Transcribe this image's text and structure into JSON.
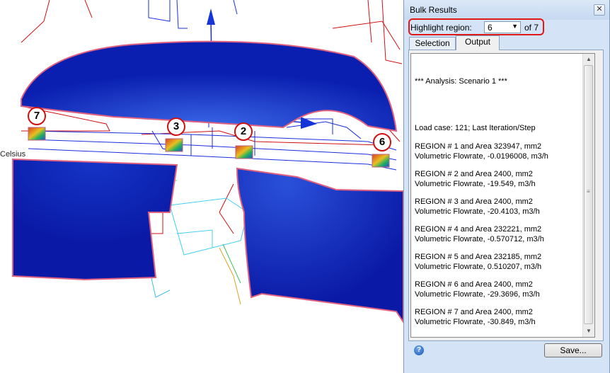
{
  "viewport": {
    "partial_label": "Celsius",
    "markers": [
      "7",
      "3",
      "2",
      "6"
    ]
  },
  "dialog": {
    "title": "Bulk Results",
    "close_glyph": "✕",
    "highlight_label": "Highlight region:",
    "highlight_value": "6",
    "highlight_of": "of 7",
    "tabs": [
      "Selection",
      "Output"
    ],
    "active_tab": "Output",
    "output_lines": [
      "*** Analysis: Scenario 1 ***",
      "Load case: 121; Last Iteration/Step",
      "REGION # 1 and Area 323947, mm2",
      "Volumetric Flowrate, -0.0196008, m3/h",
      "REGION # 2 and Area 2400, mm2",
      "Volumetric Flowrate, -19.549, m3/h",
      "REGION # 3 and Area 2400, mm2",
      "Volumetric Flowrate, -20.4103, m3/h",
      "REGION # 4 and Area 232221, mm2",
      "Volumetric Flowrate, -0.570712, m3/h",
      "REGION # 5 and Area 232185, mm2",
      "Volumetric Flowrate, 0.510207, m3/h",
      "REGION # 6 and Area 2400, mm2",
      "Volumetric Flowrate, -29.3696, m3/h",
      "REGION # 7 and Area 2400, mm2",
      "Volumetric Flowrate, -30.849, m3/h"
    ],
    "help_glyph": "?",
    "save_label": "Save..."
  },
  "colors": {
    "flow_blue": "#0a1fb0",
    "outline_red": "#d01010",
    "dialog_bg": "#d4e4f6"
  }
}
